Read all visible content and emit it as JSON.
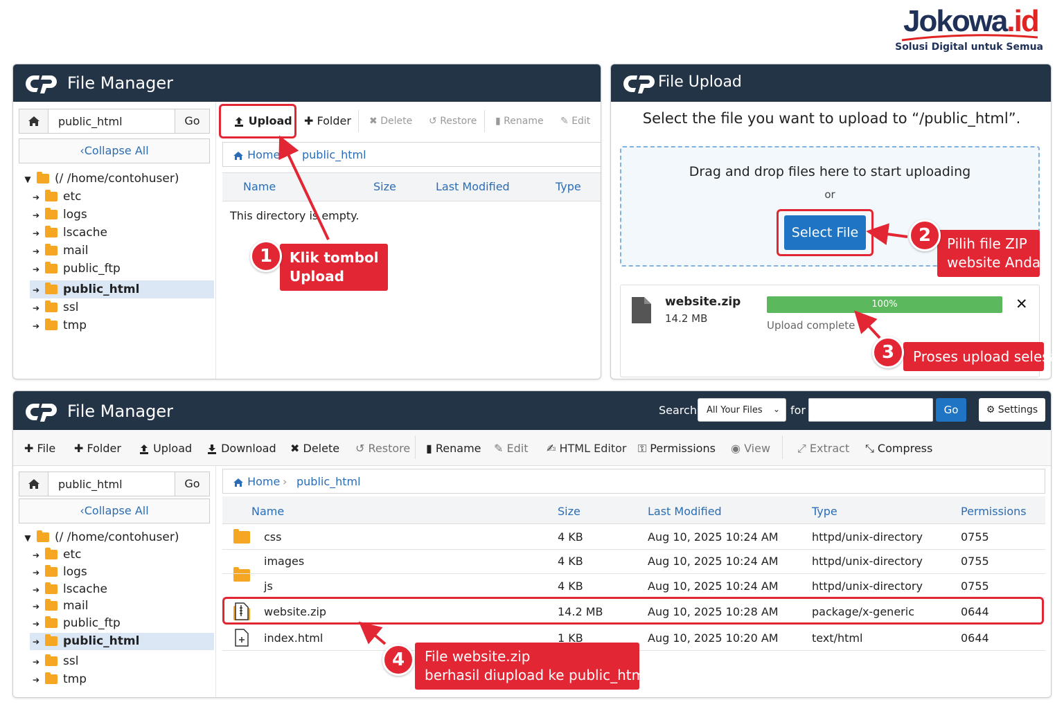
{
  "brand": {
    "name_main": "Jokowa",
    "name_suffix": ".id",
    "tagline": "Solusi Digital untuk Semua"
  },
  "panel_top_left": {
    "title": "File Manager",
    "path_value": "public_html",
    "go_label": "Go",
    "collapse_label": "Collapse All",
    "tree": {
      "root": "(/ /home/contohuser)",
      "items": [
        "etc",
        "logs",
        "lscache",
        "mail",
        "public_ftp",
        "public_html",
        "ssl",
        "tmp"
      ],
      "selected": "public_html"
    },
    "toolbar": {
      "upload": "Upload",
      "folder": "Folder",
      "delete": "Delete",
      "restore": "Restore",
      "rename": "Rename",
      "edit": "Edit"
    },
    "breadcrumb": {
      "home": "Home",
      "current": "public_html"
    },
    "columns": [
      "Name",
      "Size",
      "Last Modified",
      "Type"
    ],
    "empty_message": "This directory is empty."
  },
  "panel_upload": {
    "title": "File Upload",
    "instruction": "Select the file you want to upload to “/public_html”.",
    "dropzone_text": "Drag and drop files here to start uploading",
    "or_text": "or",
    "select_file_label": "Select File",
    "file": {
      "name": "website.zip",
      "size": "14.2 MB",
      "progress_label": "100%",
      "progress": 1.0,
      "status": "Upload complete"
    },
    "close_glyph": "✕"
  },
  "panel_bottom": {
    "title": "File Manager",
    "search_label": "Search",
    "search_scope": "All Your Files",
    "for_label": "for",
    "search_value": "",
    "go_label": "Go",
    "settings_label": "Settings",
    "toolbar": {
      "file": "File",
      "folder": "Folder",
      "upload": "Upload",
      "download": "Download",
      "delete": "Delete",
      "restore": "Restore",
      "rename": "Rename",
      "edit": "Edit",
      "html_editor": "HTML Editor",
      "permissions": "Permissions",
      "view": "View",
      "extract": "Extract",
      "compress": "Compress"
    },
    "path_value": "public_html",
    "path_go": "Go",
    "collapse_label": "Collapse All",
    "tree": {
      "root": "(/ /home/contohuser)",
      "items": [
        "etc",
        "logs",
        "lscache",
        "mail",
        "public_ftp",
        "public_html",
        "ssl",
        "tmp"
      ],
      "selected": "public_html"
    },
    "breadcrumb": {
      "home": "Home",
      "current": "public_html"
    },
    "columns": {
      "name": "Name",
      "size": "Size",
      "modified": "Last Modified",
      "type": "Type",
      "perms": "Permissions"
    },
    "rows": [
      {
        "icon": "folder-icon",
        "name": "css",
        "size": "4 KB",
        "modified": "Aug 10, 2025 10:24 AM",
        "type": "httpd/unix-directory",
        "perms": "0755"
      },
      {
        "icon": "folder-icon",
        "name": "images",
        "size": "4 KB",
        "modified": "Aug 10, 2025 10:24 AM",
        "type": "httpd/unix-directory",
        "perms": "0755"
      },
      {
        "icon": "folder-icon",
        "name": "js",
        "size": "4 KB",
        "modified": "Aug 10, 2025 10:24 AM",
        "type": "httpd/unix-directory",
        "perms": "0755"
      },
      {
        "icon": "zip-file-icon",
        "name": "website.zip",
        "size": "14.2 MB",
        "modified": "Aug 10, 2025 10:28 AM",
        "type": "package/x-generic",
        "perms": "0644"
      },
      {
        "icon": "html-file-icon",
        "name": "index.html",
        "size": "1 KB",
        "modified": "Aug 10, 2025 10:20 AM",
        "type": "text/html",
        "perms": "0644"
      }
    ]
  },
  "annotations": {
    "step1": {
      "number": "1",
      "line1": "Klik tombol",
      "line2": "Upload"
    },
    "step2": {
      "number": "2",
      "line1": "Pilih file ZIP",
      "line2": "website Anda"
    },
    "step3": {
      "number": "3",
      "text": "Proses upload selesai"
    },
    "step4": {
      "number": "4",
      "line1": "File website.zip",
      "line2": "berhasil diupload ke public_html"
    }
  },
  "colors": {
    "header": "#243447",
    "accent_red": "#e32634",
    "link_blue": "#2a6db5",
    "button_blue": "#1f75c4",
    "progress_green": "#5cb85c"
  }
}
